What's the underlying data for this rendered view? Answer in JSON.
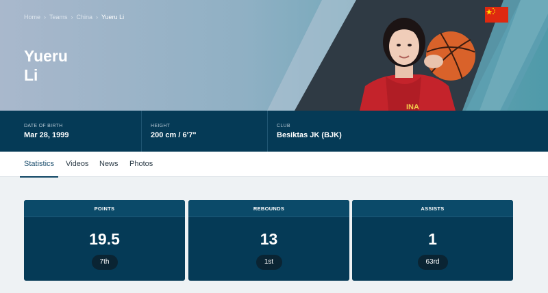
{
  "breadcrumb": [
    {
      "label": "Home"
    },
    {
      "label": "Teams"
    },
    {
      "label": "China"
    },
    {
      "label": "Yueru Li"
    }
  ],
  "player": {
    "first_name": "Yueru",
    "last_name": "Li"
  },
  "icons": {
    "breadcrumb_separator": "chevron-right-icon",
    "flag": "china-flag-icon"
  },
  "colors": {
    "navy": "#053a56",
    "flag_red": "#de2910",
    "flag_star": "#ffde00"
  },
  "info": [
    {
      "label": "DATE OF BIRTH",
      "value": "Mar 28, 1999"
    },
    {
      "label": "HEIGHT",
      "value": "200 cm / 6'7\""
    },
    {
      "label": "CLUB",
      "value": "Besiktas JK (BJK)"
    }
  ],
  "tabs": [
    {
      "label": "Statistics",
      "active": true
    },
    {
      "label": "Videos"
    },
    {
      "label": "News"
    },
    {
      "label": "Photos"
    }
  ],
  "stats": [
    {
      "label": "POINTS",
      "value": "19.5",
      "rank": "7th"
    },
    {
      "label": "REBOUNDS",
      "value": "13",
      "rank": "1st"
    },
    {
      "label": "ASSISTS",
      "value": "1",
      "rank": "63rd"
    }
  ]
}
